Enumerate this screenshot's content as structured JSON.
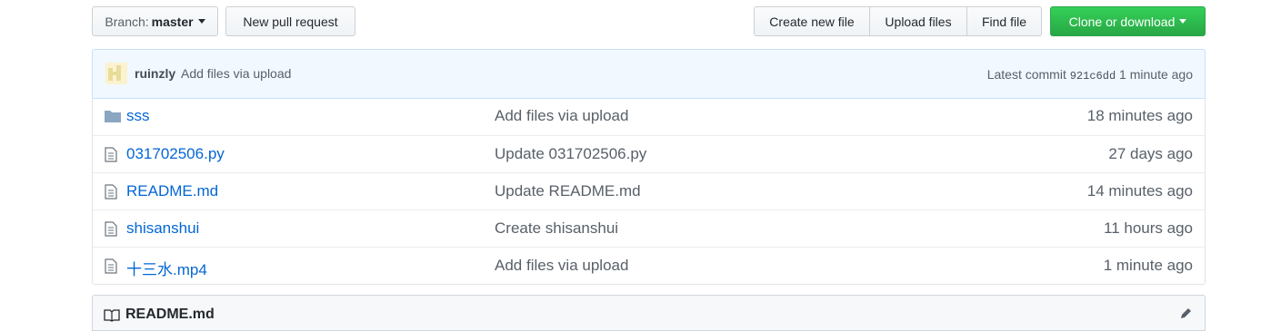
{
  "toolbar": {
    "branch_prefix": "Branch:",
    "branch_name": "master",
    "new_pull_request": "New pull request",
    "create_new_file": "Create new file",
    "upload_files": "Upload files",
    "find_file": "Find file",
    "clone_or_download": "Clone or download"
  },
  "commit": {
    "author": "ruinzly",
    "message": "Add files via upload",
    "latest_label": "Latest commit",
    "sha": "921c6dd",
    "age": "1 minute ago"
  },
  "files": [
    {
      "name": "sss",
      "icon": "folder-icon",
      "message": "Add files via upload",
      "age": "18 minutes ago"
    },
    {
      "name": "031702506.py",
      "icon": "file-icon",
      "message": "Update 031702506.py",
      "age": "27 days ago"
    },
    {
      "name": "README.md",
      "icon": "file-icon",
      "message": "Update README.md",
      "age": "14 minutes ago"
    },
    {
      "name": "shisanshui",
      "icon": "file-icon",
      "message": "Create shisanshui",
      "age": "11 hours ago"
    },
    {
      "name": "十三水.mp4",
      "icon": "file-icon",
      "message": "Add files via upload",
      "age": "1 minute ago"
    }
  ],
  "readme": {
    "title": "README.md"
  },
  "colors": {
    "accent_link": "#0366d6",
    "clone_button": "#28a745",
    "commit_bar_bg": "#f1f8ff"
  }
}
